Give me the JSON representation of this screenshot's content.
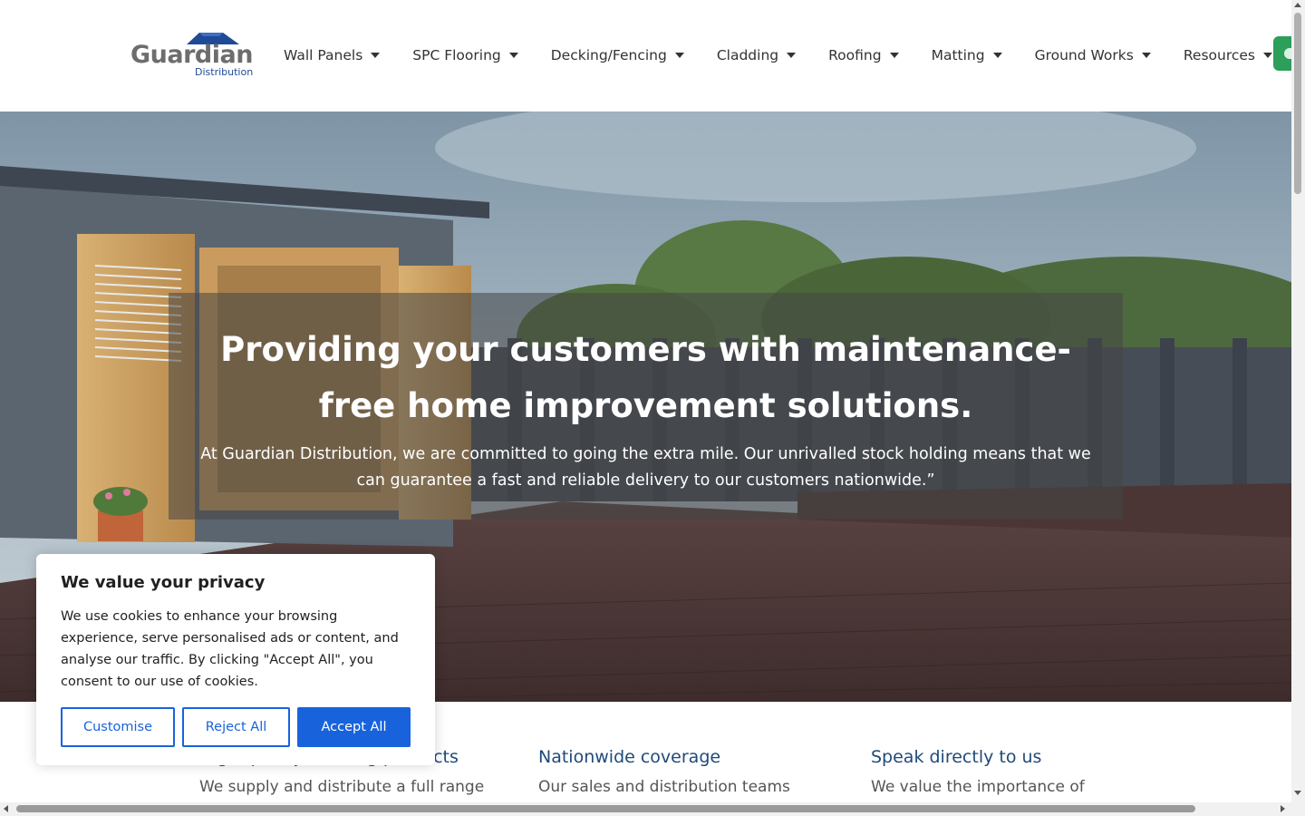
{
  "brand": {
    "name": "Guardian",
    "subtitle": "Distribution",
    "primary_color": "#1f4a96",
    "accent_color": "#2e9e5b"
  },
  "nav": {
    "items": [
      {
        "label": "Wall Panels",
        "icon": "caret-down-icon"
      },
      {
        "label": "SPC Flooring",
        "icon": "caret-down-icon"
      },
      {
        "label": "Decking/Fencing",
        "icon": "caret-down-icon"
      },
      {
        "label": "Cladding",
        "icon": "caret-down-icon"
      },
      {
        "label": "Roofing",
        "icon": "caret-down-icon"
      },
      {
        "label": "Matting",
        "icon": "caret-down-icon"
      },
      {
        "label": "Ground Works",
        "icon": "caret-down-icon"
      },
      {
        "label": "Resources",
        "icon": "caret-down-icon"
      }
    ]
  },
  "hero": {
    "title": "Providing your customers with maintenance-free home improvement solutions.",
    "text": "At Guardian Distribution, we are committed to going the extra mile. Our unrivalled stock holding means that we can guarantee a fast and reliable delivery to our customers nationwide.”"
  },
  "features": [
    {
      "title": "High quality building products",
      "text": "We supply and distribute a full range"
    },
    {
      "title": "Nationwide coverage",
      "text": "Our sales and distribution teams"
    },
    {
      "title": "Speak directly to us",
      "text": "We value the importance of"
    }
  ],
  "cookie": {
    "title": "We value your privacy",
    "text": "We use cookies to enhance your browsing experience, serve personalised ads or content, and analyse our traffic. By clicking \"Accept All\", you consent to our use of cookies.",
    "customise_label": "Customise",
    "reject_label": "Reject All",
    "accept_label": "Accept All",
    "button_color": "#1863dc"
  }
}
